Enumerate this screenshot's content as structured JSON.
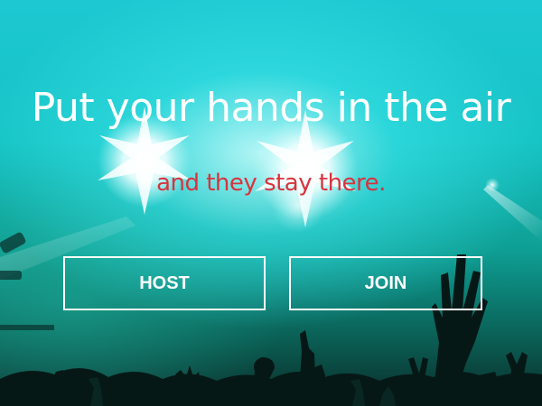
{
  "hero": {
    "headline": "Put your hands in the air",
    "tagline": "and they stay there."
  },
  "actions": {
    "host_label": "HOST",
    "join_label": "JOIN"
  },
  "colors": {
    "headline": "#ffffff",
    "tagline": "#d8333d",
    "button_border": "#ffffff",
    "background_primary": "#1dc8d2"
  }
}
